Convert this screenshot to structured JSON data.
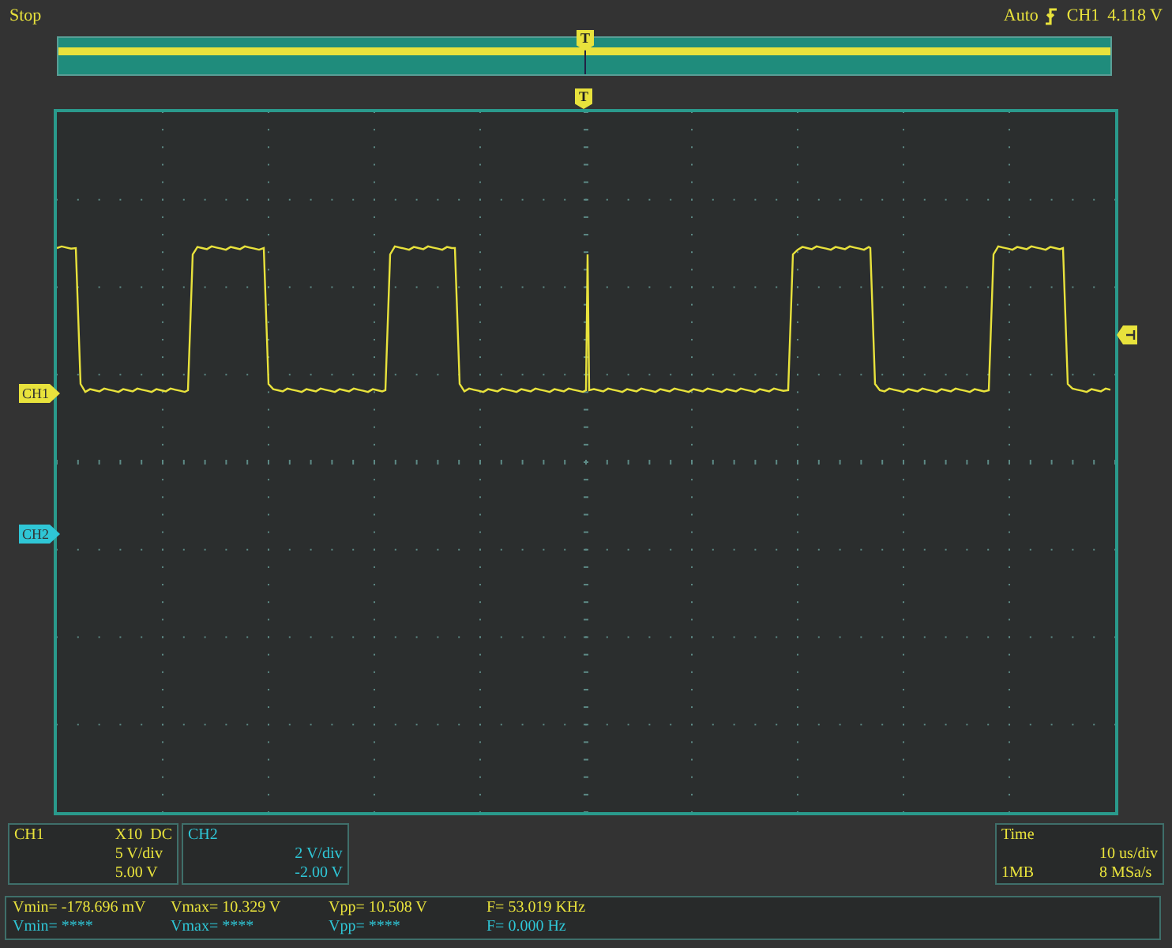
{
  "status": "Stop",
  "trigger": {
    "mode": "Auto",
    "source": "CH1",
    "level": "4.118 V"
  },
  "markers": {
    "overview_trigger_position": "T",
    "trigger_position": "T",
    "ch1": "CH1",
    "ch2": "CH2"
  },
  "channels": [
    {
      "name": "CH1",
      "color": "#e8e23c",
      "probe": "X10",
      "coupling": "DC",
      "scale": "5 V/div",
      "offset": "5.00 V"
    },
    {
      "name": "CH2",
      "color": "#2fc6d6",
      "scale": "2 V/div",
      "offset": "-2.00 V"
    }
  ],
  "timebase": {
    "title": "Time",
    "scale": "10 us/div",
    "memory": "1MB",
    "sample_rate": "8 MSa/s"
  },
  "measurements": [
    {
      "color": "#e8e23c",
      "values": [
        "Vmin= -178.696 mV",
        "Vmax= 10.329 V",
        "Vpp= 10.508 V",
        "F= 53.019 KHz"
      ]
    },
    {
      "color": "#2fc6d6",
      "values": [
        "Vmin= ****",
        "Vmax= ****",
        "Vpp= ****",
        "F= 0.000 Hz"
      ]
    }
  ]
}
